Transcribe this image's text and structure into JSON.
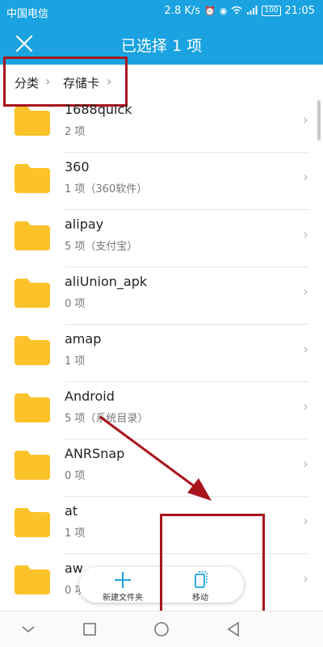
{
  "status_bar": {
    "carrier": "中国电信",
    "speed": "2.8 K/s",
    "battery": "100",
    "time": "21:05"
  },
  "title_bar": {
    "title": "已选择 1 项"
  },
  "breadcrumb": {
    "items": [
      "分类",
      "存储卡"
    ]
  },
  "files": [
    {
      "name": "1688quick",
      "info": "2 项"
    },
    {
      "name": "360",
      "info": "1 项（360软件）"
    },
    {
      "name": "alipay",
      "info": "5 项（支付宝）"
    },
    {
      "name": "aliUnion_apk",
      "info": "0 项"
    },
    {
      "name": "amap",
      "info": "1 项"
    },
    {
      "name": "Android",
      "info": "5 项（系统目录）"
    },
    {
      "name": "ANRSnap",
      "info": "0 项"
    },
    {
      "name": "at",
      "info": "1 项"
    },
    {
      "name": "aw",
      "info": "0 项"
    }
  ],
  "actions": {
    "new_folder": "新建文件夹",
    "move": "移动"
  },
  "colors": {
    "header": "#1aa3e0",
    "folder": "#fcc22a",
    "annotation": "#a8141c"
  }
}
